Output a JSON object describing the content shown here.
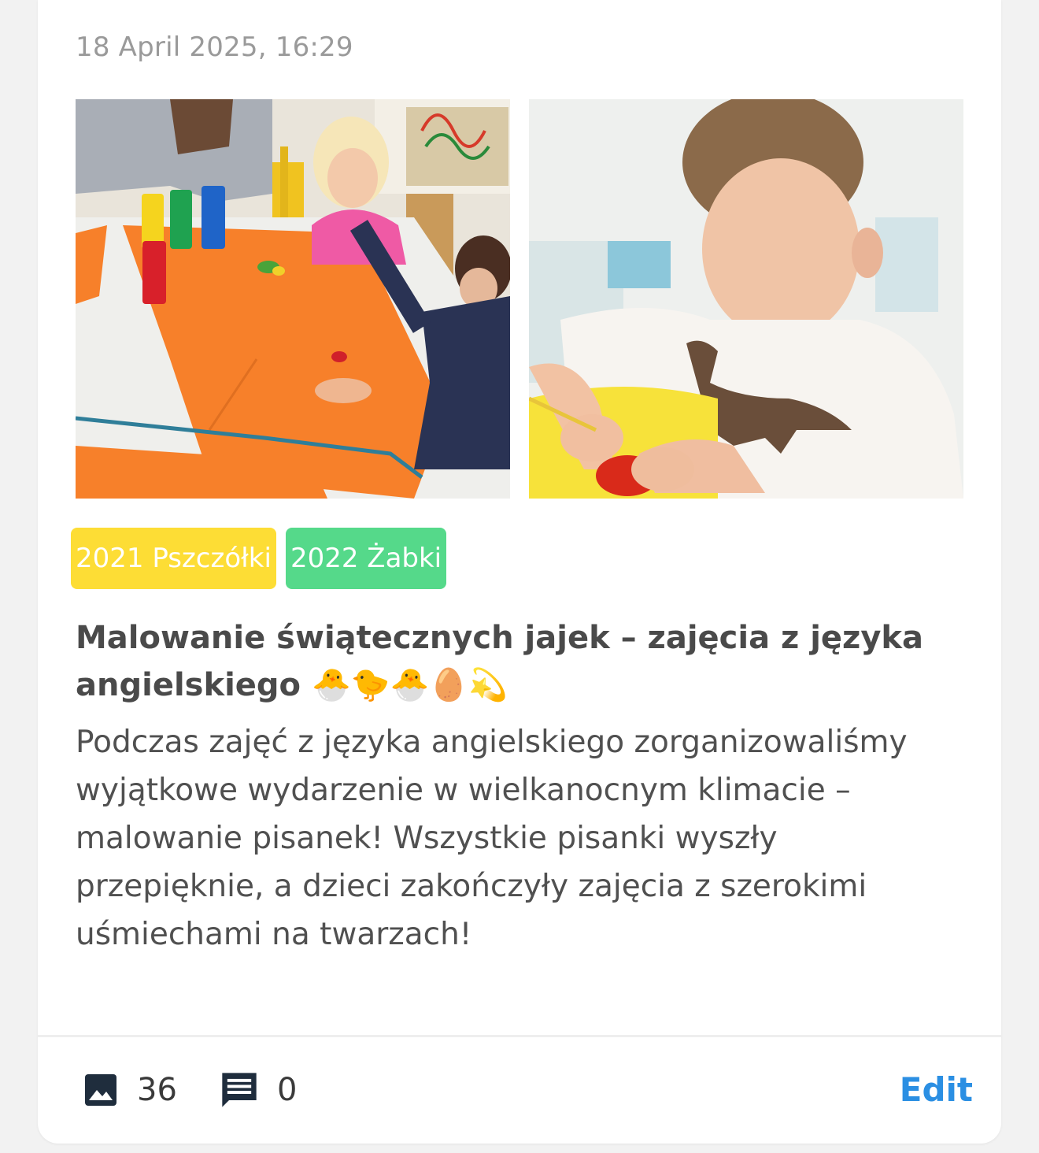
{
  "post": {
    "timestamp": "18 April 2025, 16:29",
    "tags": [
      {
        "label": "2021 Pszczółki",
        "color": "#fddd35"
      },
      {
        "label": "2022 Żabki",
        "color": "#55d98a"
      }
    ],
    "title": "Malowanie świątecznych jajek – zajęcia z języka angielskiego 🐣🐤🐣🥚💫",
    "body": "Podczas zajęć z języka angielskiego zorganizowaliśmy wyjątkowe wydarzenie w wielkanocnym klimacie – malowanie pisanek! Wszystkie pisanki wyszły przepięknie, a dzieci zakończyły zajęcia z szerokimi uśmiechami na twarzach!",
    "photos": [
      {
        "icon": "photo-children-painting"
      },
      {
        "icon": "photo-boy-painting-egg"
      }
    ]
  },
  "footer": {
    "photos_icon": "image-icon",
    "photos_count": "36",
    "comments_icon": "comment-icon",
    "comments_count": "0",
    "edit_label": "Edit",
    "edit_color": "#2b8fe3"
  }
}
